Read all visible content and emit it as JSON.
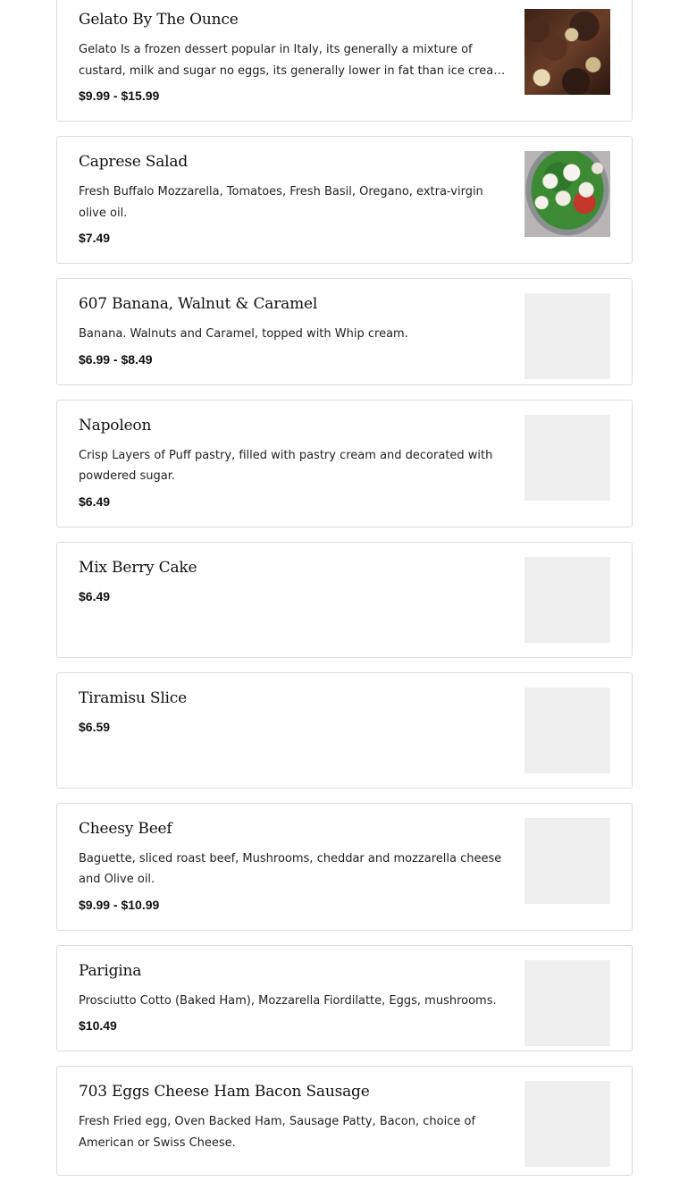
{
  "menu_items": [
    {
      "title": "Gelato By The Ounce",
      "description": "Gelato Is a frozen dessert popular in Italy, its generally a mixture of custard, milk and sugar no eggs, its generally lower in fat than ice cream and frozen...",
      "price": "$9.99 - $15.99",
      "image": "gelato-photo"
    },
    {
      "title": "Caprese Salad",
      "description": "Fresh Buffalo Mozzarella, Tomatoes, Fresh Basil, Oregano, extra-virgin olive oil.",
      "price": "$7.49",
      "image": "caprese-photo"
    },
    {
      "title": "607 Banana, Walnut & Caramel",
      "description": "Banana. Walnuts and Caramel, topped with Whip cream.",
      "price": "$6.99 - $8.49",
      "image": "placeholder"
    },
    {
      "title": "Napoleon",
      "description": "Crisp Layers of Puff pastry, filled with pastry cream and decorated with powdered sugar.",
      "price": "$6.49",
      "image": "placeholder"
    },
    {
      "title": "Mix Berry Cake",
      "description": "",
      "price": "$6.49",
      "image": "placeholder"
    },
    {
      "title": "Tiramisu Slice",
      "description": "",
      "price": "$6.59",
      "image": "placeholder"
    },
    {
      "title": "Cheesy Beef",
      "description": "Baguette, sliced roast beef, Mushrooms, cheddar and mozzarella cheese and Olive oil.",
      "price": "$9.99 - $10.99",
      "image": "placeholder"
    },
    {
      "title": "Parigina",
      "description": "Prosciutto Cotto (Baked Ham), Mozzarella Fiordilatte, Eggs, mushrooms.",
      "price": "$10.49",
      "image": "placeholder"
    },
    {
      "title": "703 Eggs Cheese Ham Bacon Sausage",
      "description": "Fresh Fried egg, Oven Backed Ham, Sausage Patty, Bacon, choice of American or Swiss Cheese.",
      "price": "",
      "image": "placeholder"
    }
  ]
}
